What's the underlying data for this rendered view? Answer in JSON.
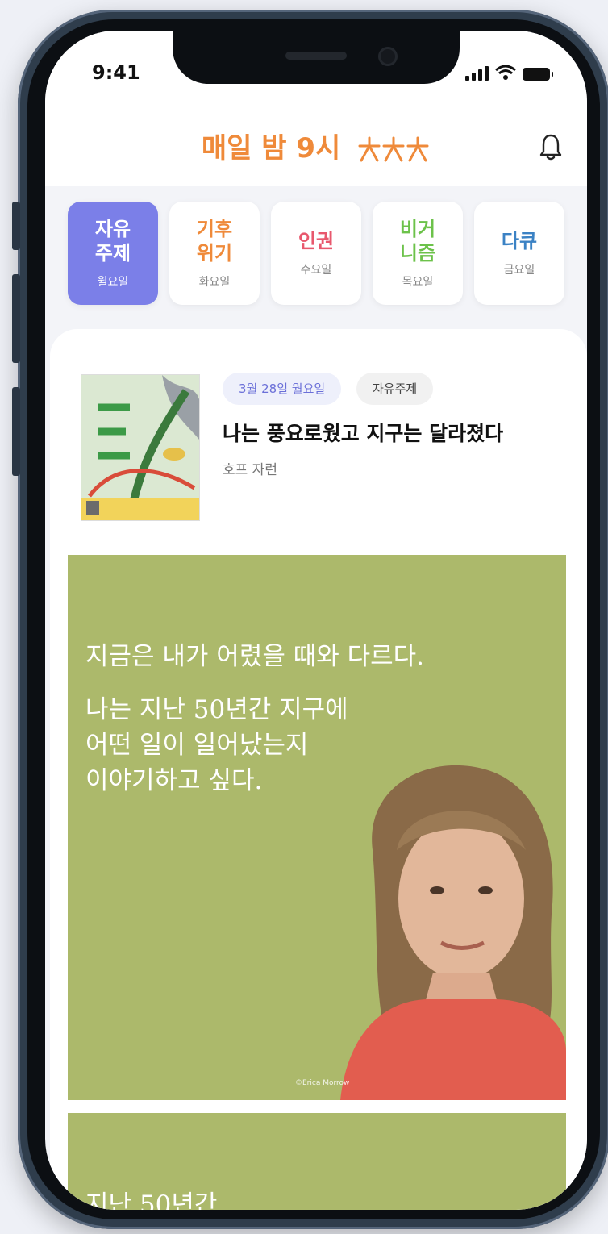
{
  "status_bar": {
    "time": "9:41"
  },
  "header": {
    "app_title": "매일 밤 9시",
    "accent_color": "#ef8a3a"
  },
  "tabs": [
    {
      "label": "자유\n주제",
      "day": "월요일",
      "color": "#ffffff",
      "active": true
    },
    {
      "label": "기후\n위기",
      "day": "화요일",
      "color": "#ef8a3a",
      "active": false
    },
    {
      "label": "인권",
      "day": "수요일",
      "color": "#e8586d",
      "active": false
    },
    {
      "label": "비거\n니즘",
      "day": "목요일",
      "color": "#6cc24a",
      "active": false
    },
    {
      "label": "다큐",
      "day": "금요일",
      "color": "#3b82c4",
      "active": false
    }
  ],
  "book": {
    "date": "3월 28일 월요일",
    "topic": "자유주제",
    "title": "나는 풍요로웠고 지구는 달라졌다",
    "author": "호프 자런"
  },
  "banner": {
    "quote_line1": "지금은 내가 어렸을 때와 다르다.",
    "quote_line2": "나는 지난 50년간 지구에\n어떤 일이 일어났는지\n이야기하고 싶다.",
    "photo_credit": "©Erica Morrow",
    "background": "#acb96b"
  },
  "banner2": {
    "peek_text": "지난 50년간"
  }
}
